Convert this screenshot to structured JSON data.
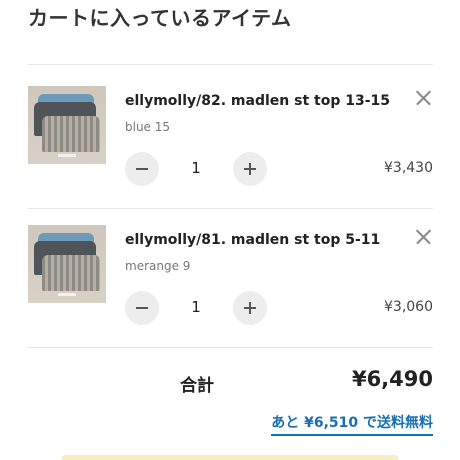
{
  "cart": {
    "heading": "カートに入っているアイテム",
    "items": [
      {
        "name": "ellymolly/82. madlen st top 13-15",
        "variant": "blue 15",
        "quantity": "1",
        "price": "¥3,430"
      },
      {
        "name": "ellymolly/81. madlen st top 5-11",
        "variant": "merange 9",
        "quantity": "1",
        "price": "¥3,060"
      }
    ],
    "total_label": "合計",
    "total_value": "¥6,490",
    "free_shipping_text": "あと ¥6,510 で送料無料"
  },
  "colors": {
    "link": "#1a6fb0",
    "button_bg": "#ededed",
    "divider": "#e8e8e8"
  }
}
